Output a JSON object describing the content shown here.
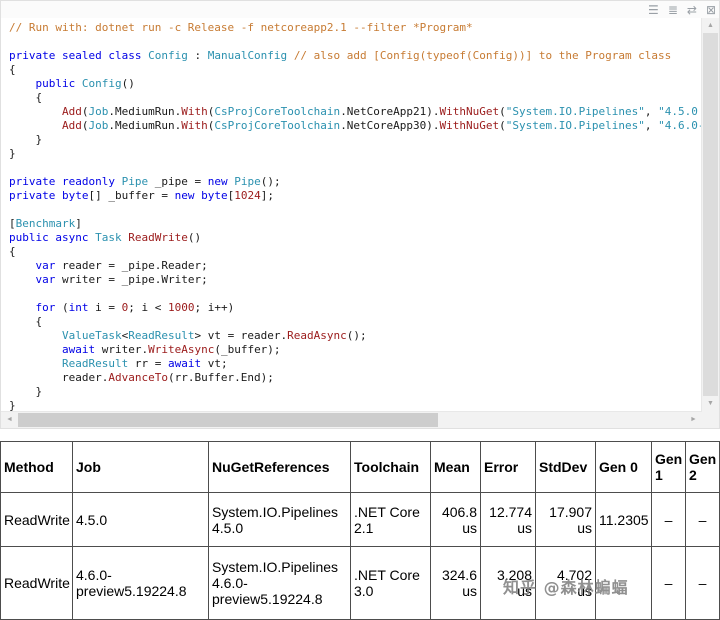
{
  "toolbar": {
    "icons": [
      {
        "name": "menu-icon",
        "glyph": "☰"
      },
      {
        "name": "list-icon",
        "glyph": "≣"
      },
      {
        "name": "swap-arrows-icon",
        "glyph": "⇄"
      },
      {
        "name": "close-icon",
        "glyph": "⊠"
      }
    ]
  },
  "code": {
    "colors": {
      "p": "#1a1a1a",
      "c": "#c77b33",
      "k": "#0000e6",
      "t": "#2b91af",
      "s": "#2b91af",
      "m": "#9b1b1b",
      "n": "#9b1b1b"
    },
    "lines": [
      [
        [
          "// Run with: dotnet run -c Release -f netcoreapp2.1 --filter *Program*",
          "c"
        ]
      ],
      [],
      [
        [
          "private sealed class ",
          "k"
        ],
        [
          "Config",
          "t"
        ],
        [
          " : ",
          "p"
        ],
        [
          "ManualConfig",
          "t"
        ],
        [
          " ",
          "p"
        ],
        [
          "// also add [Config(typeof(Config))] to the Program class",
          "c"
        ]
      ],
      [
        [
          "{",
          "p"
        ]
      ],
      [
        [
          "    ",
          "p"
        ],
        [
          "public ",
          "k"
        ],
        [
          "Config",
          "t"
        ],
        [
          "()",
          "p"
        ]
      ],
      [
        [
          "    {",
          "p"
        ]
      ],
      [
        [
          "        ",
          "p"
        ],
        [
          "Add",
          "m"
        ],
        [
          "(",
          "p"
        ],
        [
          "Job",
          "t"
        ],
        [
          ".MediumRun.",
          "p"
        ],
        [
          "With",
          "m"
        ],
        [
          "(",
          "p"
        ],
        [
          "CsProjCoreToolchain",
          "t"
        ],
        [
          ".NetCoreApp21).",
          "p"
        ],
        [
          "WithNuGet",
          "m"
        ],
        [
          "(",
          "p"
        ],
        [
          "\"System.IO.Pipelines\"",
          "s"
        ],
        [
          ", ",
          "p"
        ],
        [
          "\"4.5.0",
          "s"
        ]
      ],
      [
        [
          "        ",
          "p"
        ],
        [
          "Add",
          "m"
        ],
        [
          "(",
          "p"
        ],
        [
          "Job",
          "t"
        ],
        [
          ".MediumRun.",
          "p"
        ],
        [
          "With",
          "m"
        ],
        [
          "(",
          "p"
        ],
        [
          "CsProjCoreToolchain",
          "t"
        ],
        [
          ".NetCoreApp30).",
          "p"
        ],
        [
          "WithNuGet",
          "m"
        ],
        [
          "(",
          "p"
        ],
        [
          "\"System.IO.Pipelines\"",
          "s"
        ],
        [
          ", ",
          "p"
        ],
        [
          "\"4.6.0-",
          "s"
        ]
      ],
      [
        [
          "    }",
          "p"
        ]
      ],
      [
        [
          "}",
          "p"
        ]
      ],
      [],
      [
        [
          "private readonly ",
          "k"
        ],
        [
          "Pipe",
          "t"
        ],
        [
          " _pipe = ",
          "p"
        ],
        [
          "new",
          "k"
        ],
        [
          " ",
          "p"
        ],
        [
          "Pipe",
          "t"
        ],
        [
          "();",
          "p"
        ]
      ],
      [
        [
          "private ",
          "k"
        ],
        [
          "byte",
          "k"
        ],
        [
          "[] _buffer = ",
          "p"
        ],
        [
          "new",
          "k"
        ],
        [
          " ",
          "p"
        ],
        [
          "byte",
          "k"
        ],
        [
          "[",
          "p"
        ],
        [
          "1024",
          "n"
        ],
        [
          "];",
          "p"
        ]
      ],
      [],
      [
        [
          "[",
          "p"
        ],
        [
          "Benchmark",
          "t"
        ],
        [
          "]",
          "p"
        ]
      ],
      [
        [
          "public async ",
          "k"
        ],
        [
          "Task",
          "t"
        ],
        [
          " ",
          "p"
        ],
        [
          "ReadWrite",
          "m"
        ],
        [
          "()",
          "p"
        ]
      ],
      [
        [
          "{",
          "p"
        ]
      ],
      [
        [
          "    ",
          "p"
        ],
        [
          "var",
          "k"
        ],
        [
          " reader = _pipe.Reader;",
          "p"
        ]
      ],
      [
        [
          "    ",
          "p"
        ],
        [
          "var",
          "k"
        ],
        [
          " writer = _pipe.Writer;",
          "p"
        ]
      ],
      [],
      [
        [
          "    ",
          "p"
        ],
        [
          "for",
          "k"
        ],
        [
          " (",
          "p"
        ],
        [
          "int",
          "k"
        ],
        [
          " i = ",
          "p"
        ],
        [
          "0",
          "n"
        ],
        [
          "; i < ",
          "p"
        ],
        [
          "1000",
          "n"
        ],
        [
          "; i++)",
          "p"
        ]
      ],
      [
        [
          "    {",
          "p"
        ]
      ],
      [
        [
          "        ",
          "p"
        ],
        [
          "ValueTask",
          "t"
        ],
        [
          "<",
          "p"
        ],
        [
          "ReadResult",
          "t"
        ],
        [
          "> vt = reader.",
          "p"
        ],
        [
          "ReadAsync",
          "m"
        ],
        [
          "();",
          "p"
        ]
      ],
      [
        [
          "        ",
          "p"
        ],
        [
          "await",
          "k"
        ],
        [
          " writer.",
          "p"
        ],
        [
          "WriteAsync",
          "m"
        ],
        [
          "(_buffer);",
          "p"
        ]
      ],
      [
        [
          "        ",
          "p"
        ],
        [
          "ReadResult",
          "t"
        ],
        [
          " rr = ",
          "p"
        ],
        [
          "await",
          "k"
        ],
        [
          " vt;",
          "p"
        ]
      ],
      [
        [
          "        reader.",
          "p"
        ],
        [
          "AdvanceTo",
          "m"
        ],
        [
          "(rr.Buffer.End);",
          "p"
        ]
      ],
      [
        [
          "    }",
          "p"
        ]
      ],
      [
        [
          "}",
          "p"
        ]
      ]
    ]
  },
  "scrollbars": {
    "left_arrow": "◄",
    "right_arrow": "►",
    "up_arrow": "▲",
    "down_arrow": "▼"
  },
  "table": {
    "headers": [
      "Method",
      "Job",
      "NuGetReferences",
      "Toolchain",
      "Mean",
      "Error",
      "StdDev",
      "Gen 0",
      "Gen 1",
      "Gen 2"
    ],
    "rows": [
      [
        "ReadWrite",
        "4.5.0",
        "System.IO.Pipelines 4.5.0",
        ".NET Core 2.1",
        "406.8 us",
        "12.774 us",
        "17.907 us",
        "11.2305",
        "–",
        "–"
      ],
      [
        "ReadWrite",
        "4.6.0-preview5.19224.8",
        "System.IO.Pipelines 4.6.0-preview5.19224.8",
        ".NET Core 3.0",
        "324.6 us",
        "3.208 us",
        "4.702 us",
        "",
        "–",
        "–"
      ]
    ]
  },
  "watermark": {
    "text": "知乎 @森林蝙蝠"
  }
}
